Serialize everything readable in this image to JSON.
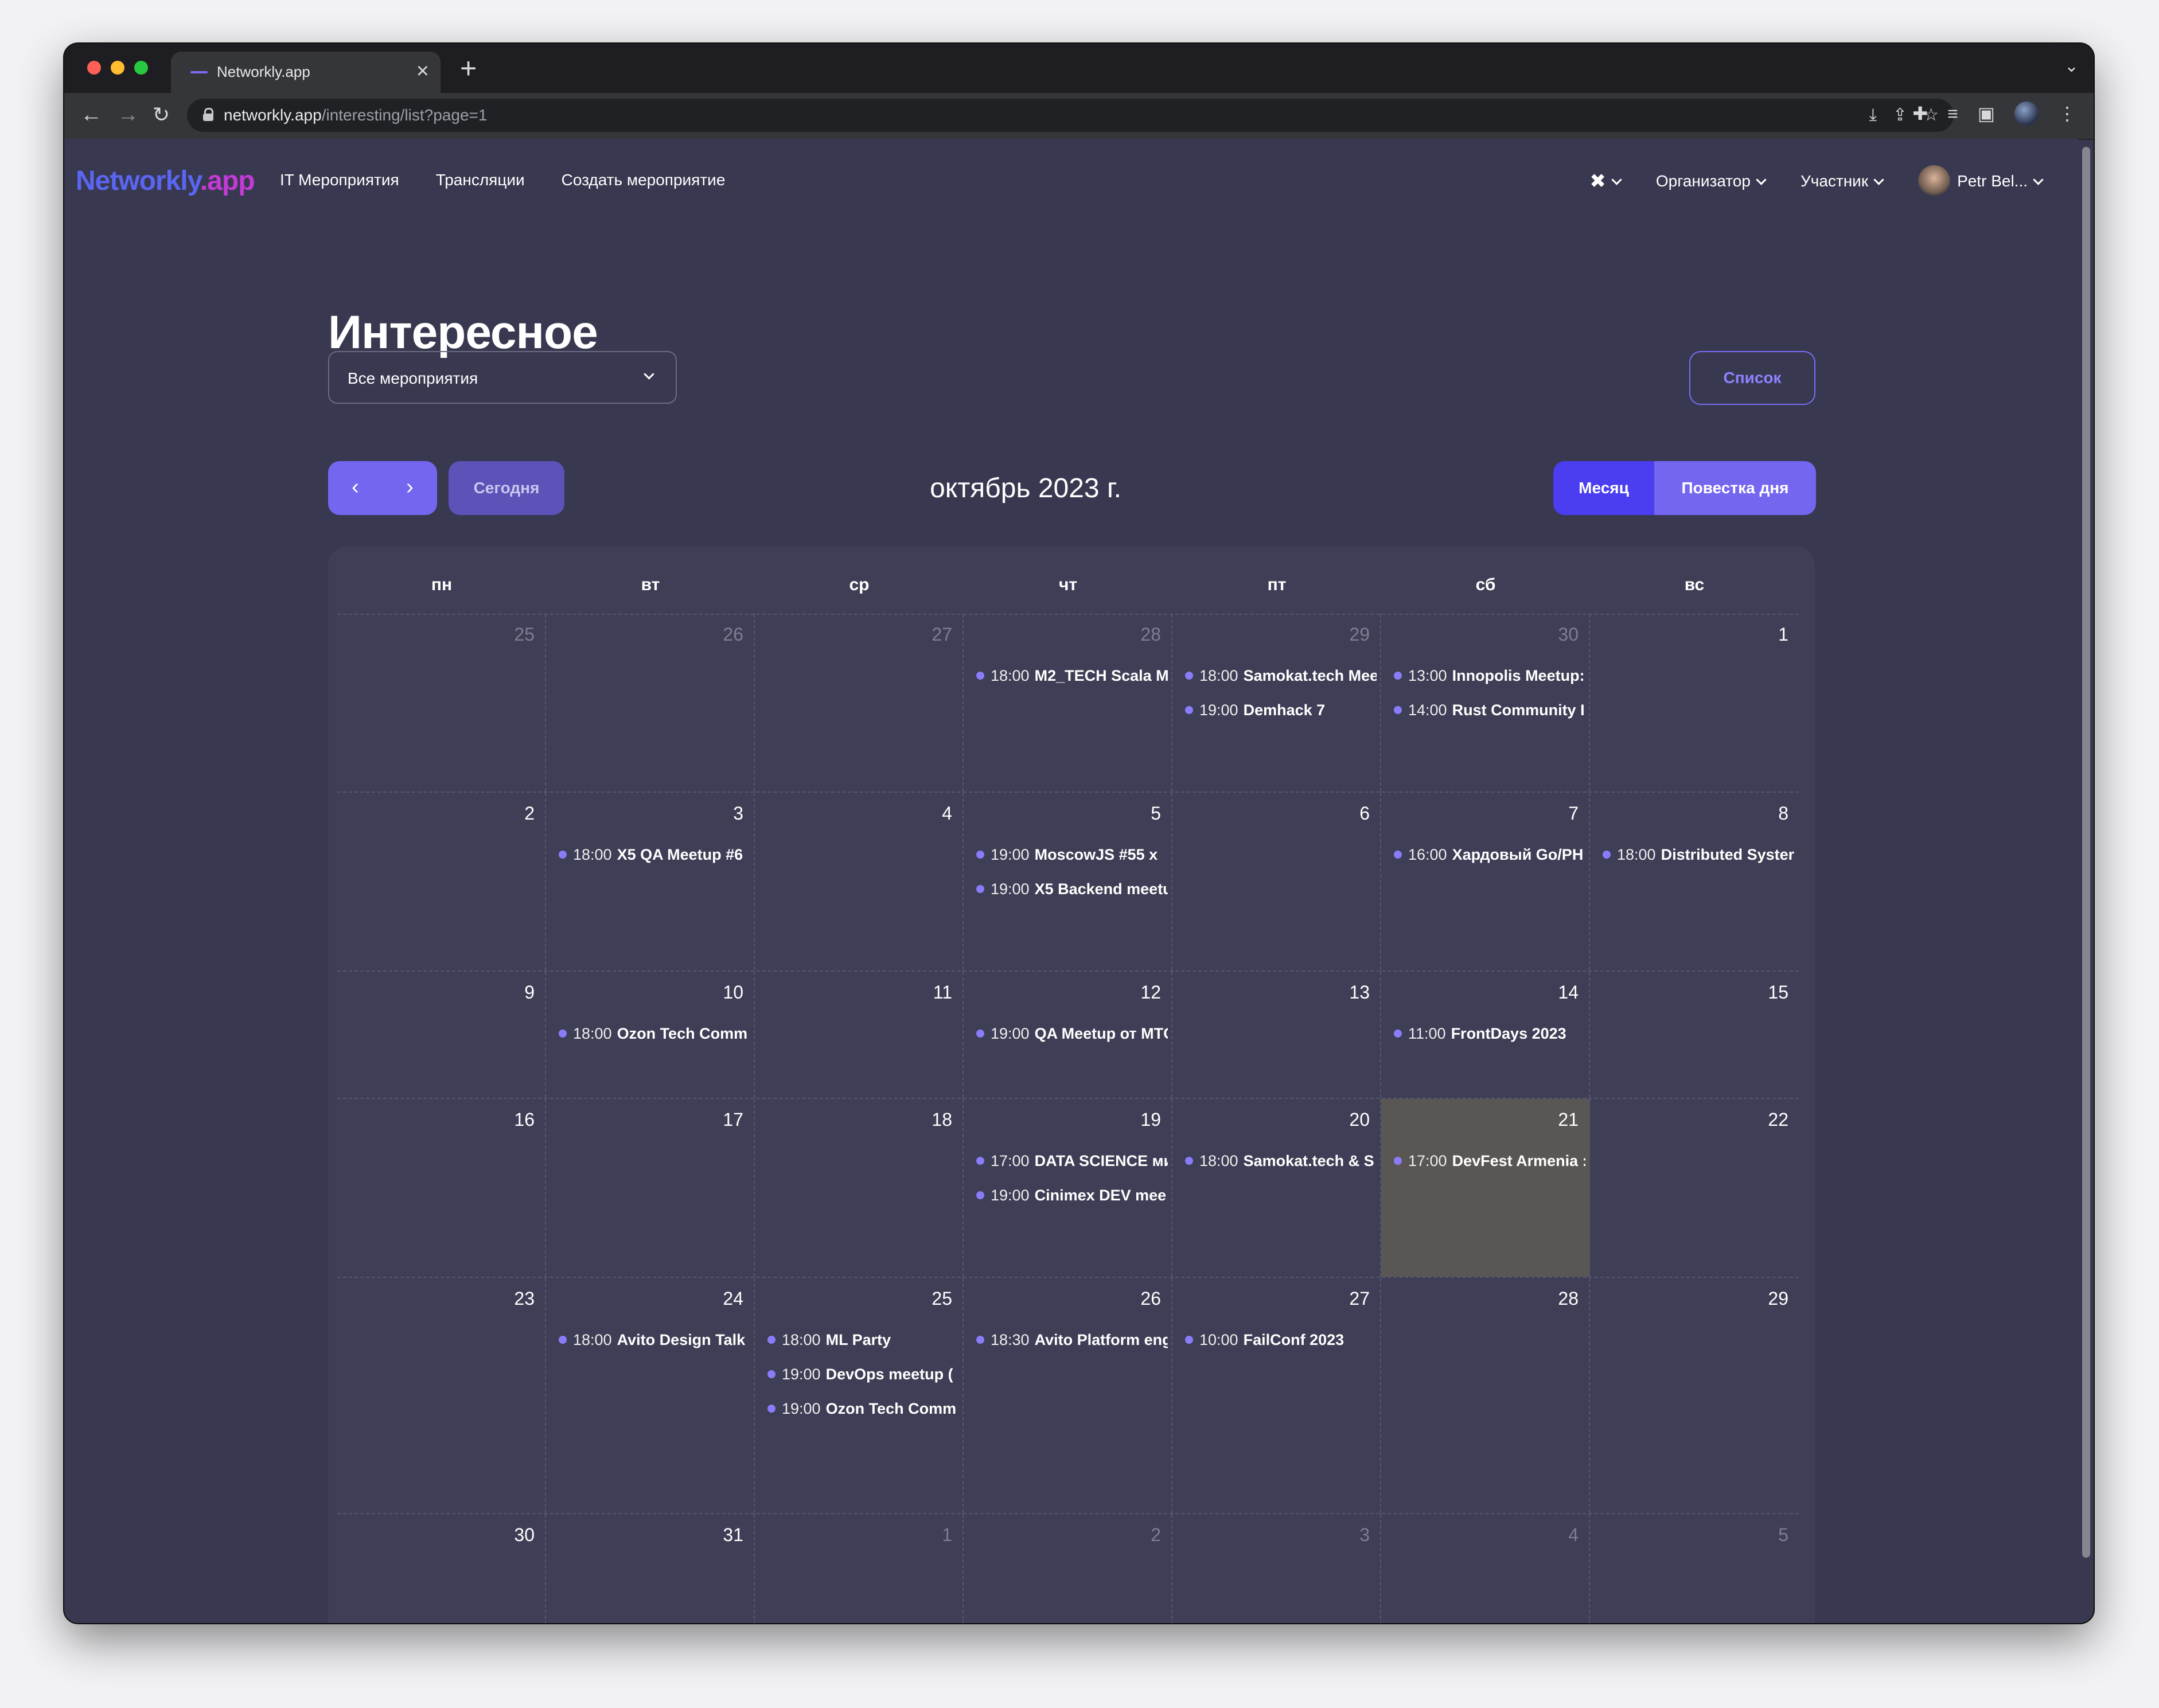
{
  "browser": {
    "tab_title": "Networkly.app",
    "tab_close": "×",
    "new_tab": "+",
    "tab_menu": "⌄",
    "url_domain": "networkly.app",
    "url_path": "/interesting/list?page=1",
    "nav": {
      "back": "←",
      "forward": "→",
      "reload": "↻"
    },
    "omni_icons": [
      "⤓",
      "⇪",
      "☆"
    ],
    "ext_icons": [
      "✚",
      "≡",
      "▣",
      "⋮"
    ]
  },
  "header": {
    "logo_part1": "Networkly",
    "logo_part2": ".app",
    "nav": [
      "IT Мероприятия",
      "Трансляции",
      "Создать мероприятие"
    ],
    "tools_icon": "✖",
    "organizer": "Организатор",
    "participant": "Участник",
    "user_name": "Petr Bel..."
  },
  "page": {
    "title": "Интересное",
    "filter_value": "Все мероприятия",
    "list_button": "Список"
  },
  "calendar": {
    "prev": "‹",
    "next": "›",
    "today": "Сегодня",
    "month_title": "октябрь 2023 г.",
    "view_month": "Месяц",
    "view_agenda": "Повестка дня",
    "weekdays": [
      "пн",
      "вт",
      "ср",
      "чт",
      "пт",
      "сб",
      "вс"
    ],
    "weeks": [
      {
        "days": [
          {
            "num": "25",
            "other": true,
            "events": []
          },
          {
            "num": "26",
            "other": true,
            "events": []
          },
          {
            "num": "27",
            "other": true,
            "events": []
          },
          {
            "num": "28",
            "other": true,
            "events": [
              {
                "time": "18:00",
                "title": "M2_TECH Scala M"
              }
            ]
          },
          {
            "num": "29",
            "other": true,
            "events": [
              {
                "time": "18:00",
                "title": "Samokat.tech Mee"
              },
              {
                "time": "19:00",
                "title": "Demhack 7"
              }
            ]
          },
          {
            "num": "30",
            "other": true,
            "events": [
              {
                "time": "13:00",
                "title": "Innopolis Meetup:"
              },
              {
                "time": "14:00",
                "title": "Rust Community I"
              }
            ]
          },
          {
            "num": "1",
            "events": []
          }
        ]
      },
      {
        "days": [
          {
            "num": "2",
            "events": []
          },
          {
            "num": "3",
            "events": [
              {
                "time": "18:00",
                "title": "X5 QA Meetup #6"
              }
            ]
          },
          {
            "num": "4",
            "events": []
          },
          {
            "num": "5",
            "events": [
              {
                "time": "19:00",
                "title": "MoscowJS #55 x"
              },
              {
                "time": "19:00",
                "title": "X5 Backend meetu"
              }
            ]
          },
          {
            "num": "6",
            "events": []
          },
          {
            "num": "7",
            "events": [
              {
                "time": "16:00",
                "title": "Хардовый Go/PH"
              }
            ]
          },
          {
            "num": "8",
            "events": [
              {
                "time": "18:00",
                "title": "Distributed Syster"
              }
            ]
          }
        ]
      },
      {
        "days": [
          {
            "num": "9",
            "events": []
          },
          {
            "num": "10",
            "events": [
              {
                "time": "18:00",
                "title": "Ozon Tech Comm"
              }
            ]
          },
          {
            "num": "11",
            "events": []
          },
          {
            "num": "12",
            "events": [
              {
                "time": "19:00",
                "title": "QA Meetup от MTC"
              }
            ]
          },
          {
            "num": "13",
            "events": []
          },
          {
            "num": "14",
            "events": [
              {
                "time": "11:00",
                "title": "FrontDays 2023"
              }
            ]
          },
          {
            "num": "15",
            "events": []
          }
        ]
      },
      {
        "days": [
          {
            "num": "16",
            "events": []
          },
          {
            "num": "17",
            "events": []
          },
          {
            "num": "18",
            "events": []
          },
          {
            "num": "19",
            "events": [
              {
                "time": "17:00",
                "title": "DATA SCIENCE ми"
              },
              {
                "time": "19:00",
                "title": "Cinimex DEV mee"
              }
            ]
          },
          {
            "num": "20",
            "events": [
              {
                "time": "18:00",
                "title": "Samokat.tech & S"
              }
            ]
          },
          {
            "num": "21",
            "today": true,
            "events": [
              {
                "time": "17:00",
                "title": "DevFest Armenia :"
              }
            ]
          },
          {
            "num": "22",
            "events": []
          }
        ]
      },
      {
        "days": [
          {
            "num": "23",
            "events": []
          },
          {
            "num": "24",
            "events": [
              {
                "time": "18:00",
                "title": "Avito Design Talk"
              }
            ]
          },
          {
            "num": "25",
            "events": [
              {
                "time": "18:00",
                "title": "ML Party"
              },
              {
                "time": "19:00",
                "title": "DevOps meetup ("
              },
              {
                "time": "19:00",
                "title": "Ozon Tech Comm"
              }
            ]
          },
          {
            "num": "26",
            "events": [
              {
                "time": "18:30",
                "title": "Avito Platform eng"
              }
            ]
          },
          {
            "num": "27",
            "events": [
              {
                "time": "10:00",
                "title": "FailConf 2023"
              }
            ]
          },
          {
            "num": "28",
            "events": []
          },
          {
            "num": "29",
            "events": []
          }
        ]
      },
      {
        "days": [
          {
            "num": "30",
            "events": []
          },
          {
            "num": "31",
            "events": []
          },
          {
            "num": "1",
            "other": true,
            "events": []
          },
          {
            "num": "2",
            "other": true,
            "events": []
          },
          {
            "num": "3",
            "other": true,
            "events": []
          },
          {
            "num": "4",
            "other": true,
            "events": []
          },
          {
            "num": "5",
            "other": true,
            "events": []
          }
        ]
      }
    ]
  },
  "colors": {
    "background": "#383850",
    "accent": "#7566f0",
    "accent_active": "#4b3ef0",
    "event_dot": "#8a7cf8",
    "today_cell": "#5a5654"
  }
}
